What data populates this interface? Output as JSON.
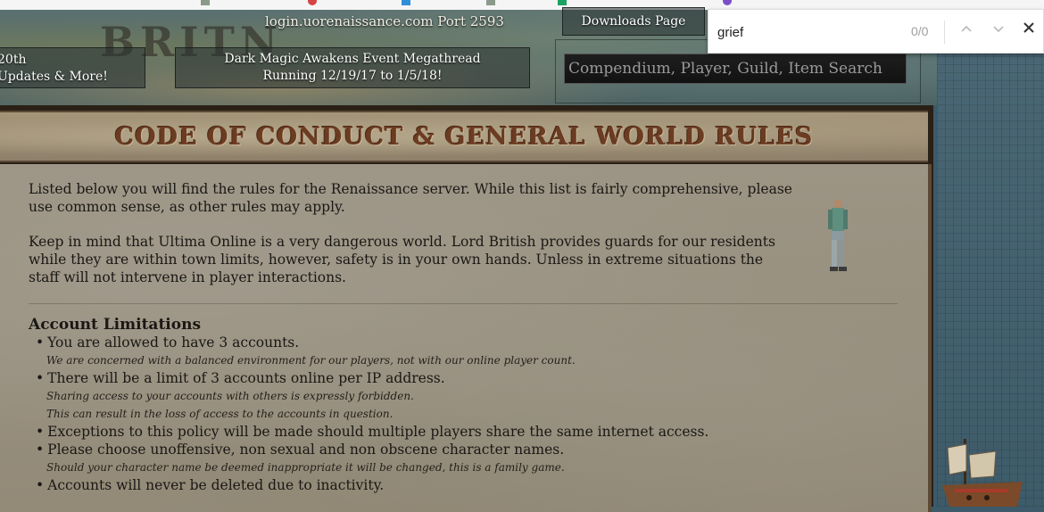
{
  "header": {
    "map_text": "BRITN",
    "login": "login.uorenaissance.com Port 2593",
    "left_button": {
      "line1": "20th",
      "line2": "Updates & More!"
    },
    "event_button": {
      "line1": "Dark Magic Awakens Event Megathread",
      "line2": "Running 12/19/17 to 1/5/18!"
    },
    "downloads": "Downloads Page",
    "search_placeholder": "Compendium, Player, Guild, Item Search"
  },
  "findbar": {
    "query": "grief",
    "count": "0/0"
  },
  "panel": {
    "title": "CODE OF CONDUCT & GENERAL WORLD RULES",
    "intro": [
      "Listed below you will find the rules for the Renaissance server. While this list is fairly comprehensive, please use common sense, as other rules may apply.",
      "Keep in mind that Ultima Online is a very dangerous world. Lord British provides guards for our residents while they are within town limits, however, safety is in your own hands. Unless in extreme situations the staff will not intervene in player interactions."
    ],
    "section_title": "Account Limitations",
    "rules": [
      {
        "text": "You are allowed to have 3 accounts.",
        "notes": [
          "We are concerned with a balanced environment for our players, not with our online player count."
        ]
      },
      {
        "text": "There will be a limit of 3 accounts online per IP address.",
        "notes": [
          "Sharing access to your accounts with others is expressly forbidden.",
          "This can result in the loss of access to the accounts in question."
        ]
      },
      {
        "text": "Exceptions to this policy will be made should multiple players share the same internet access.",
        "notes": []
      },
      {
        "text": "Please choose unoffensive, non sexual and non obscene character names.",
        "notes": [
          "Should your character name be deemed inappropriate it will be changed, this is a family game."
        ]
      },
      {
        "text": "Accounts will never be deleted due to inactivity.",
        "notes": []
      }
    ]
  },
  "colors": {
    "title_text": "#6b3b22",
    "parchment": "#9c9484",
    "frame": "#2a2016"
  }
}
